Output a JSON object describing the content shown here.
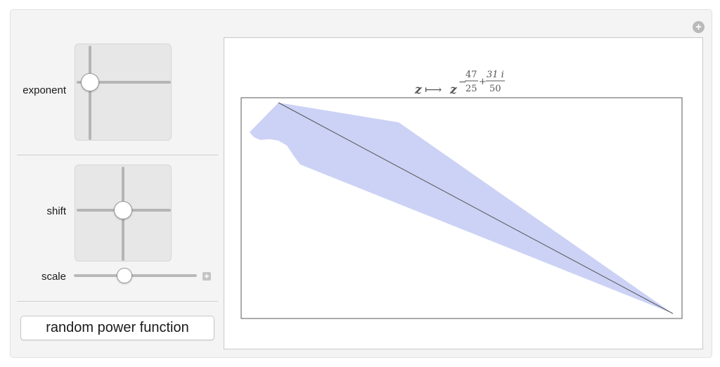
{
  "controls": {
    "exponent_label": "exponent",
    "shift_label": "shift",
    "scale_label": "scale",
    "random_button_label": "random power function"
  },
  "plot": {
    "formula": {
      "variable": "z",
      "arrow": "⟼",
      "base": "z",
      "real_sign": "−",
      "real_num": "47",
      "real_den": "25",
      "plus": "+",
      "imag_num": "31 i",
      "imag_den": "50"
    }
  },
  "colors": {
    "fill": "#ccd2f5",
    "stroke": "#555555"
  },
  "icons": {
    "panel_add": "plus-circle-icon",
    "scale_add": "plus-square-icon"
  }
}
